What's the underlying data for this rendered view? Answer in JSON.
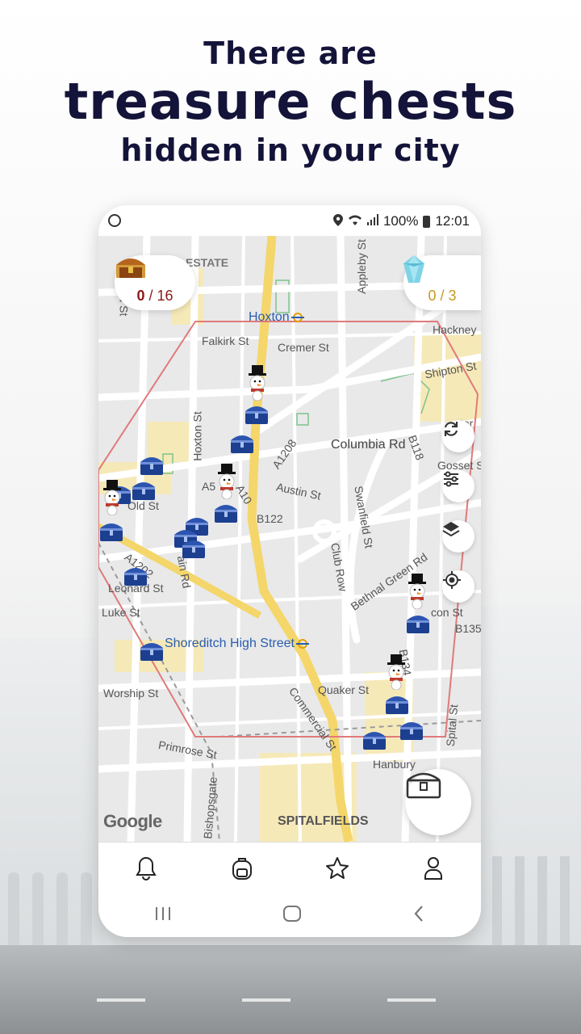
{
  "headline": {
    "line1": "There are",
    "line2": "treasure chests",
    "line3": "hidden in your city"
  },
  "statusbar": {
    "signal_percent": "100%",
    "time": "12:01",
    "icons": [
      "account-circle-icon",
      "location-icon",
      "wifi-icon",
      "signal-icon",
      "battery-icon"
    ]
  },
  "counters": {
    "chests": {
      "found": "0",
      "sep": " / ",
      "total": "16",
      "icon": "treasure-chest-icon"
    },
    "gems": {
      "text": "0 / 3",
      "icon": "crystal-gem-icon"
    }
  },
  "map": {
    "labels": {
      "estate": "ESTATE",
      "hoxton": "Hoxton",
      "hackney": "Hackney",
      "falkirk": "Falkirk St",
      "cremer": "Cremer St",
      "shipton": "Shipton St",
      "appleby": "Appleby St",
      "columbia": "Columbia Rd",
      "b118": "B118",
      "gosset": "Gosset S",
      "hoxton_st": "Hoxton St",
      "a1208": "A1208",
      "austin": "Austin St",
      "a5": "A5",
      "a10": "A10",
      "b122": "B122",
      "old": "Old St",
      "swanfield": "Swanfield St",
      "club_row": "Club Row",
      "bethnal": "Bethnal Green Rd",
      "a1202": "A1202",
      "main_rd": "ain Rd",
      "leonard": "Leonard St",
      "luke": "Luke St",
      "con": "con St",
      "b135": "B135",
      "shoreditch": "Shoreditch High Street",
      "b134": "B134",
      "worship": "Worship St",
      "quaker": "Quaker St",
      "commercial": "Commercial St",
      "spital": "Spital St",
      "primrose": "Primrose St",
      "hanbury": "Hanbury",
      "bishopsgate": "Bishopsgate",
      "spitalfields": "SPITALFIELDS",
      "field_st": "field St",
      "ter": "ter"
    },
    "google": "Google",
    "buttons": [
      "refresh-icon",
      "filter-sliders-icon",
      "layers-icon",
      "my-location-icon",
      "chest-inventory-icon"
    ]
  },
  "bottom_nav": [
    "bell-icon",
    "backpack-icon",
    "star-icon",
    "profile-icon"
  ],
  "system_nav": [
    "recents-icon",
    "home-icon",
    "back-icon"
  ],
  "colors": {
    "headline": "#14143a",
    "chest_found": "#8b1a1a",
    "gem_count": "#c79a1e",
    "zone_outline": "#e07a7a",
    "chest_marker": "#1c3f8f",
    "station": "#2a5db0"
  }
}
